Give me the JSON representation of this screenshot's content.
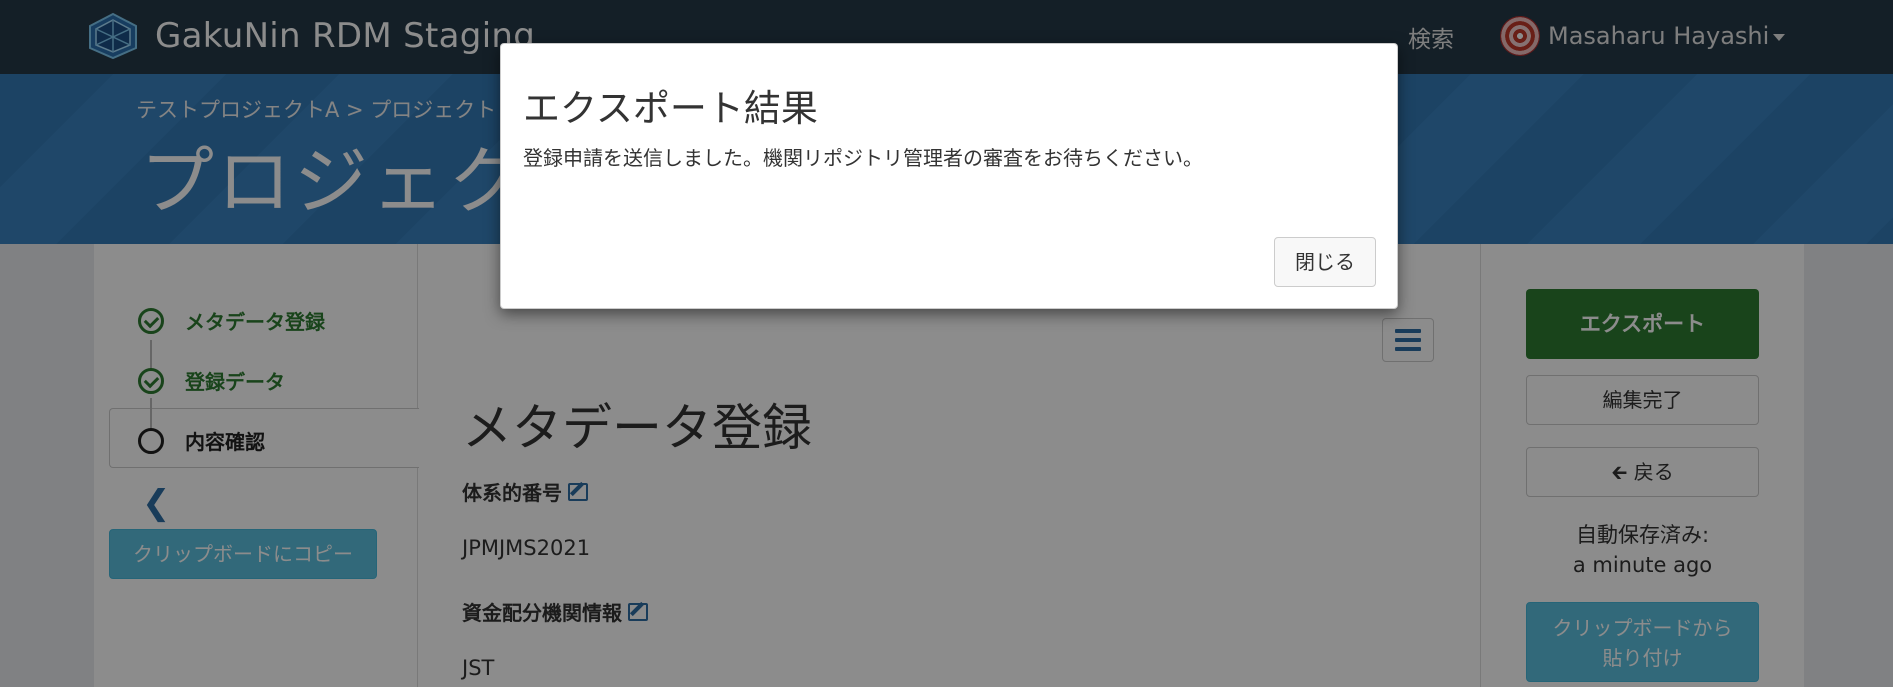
{
  "navbar": {
    "brand": "GakuNin RDM Staging",
    "search_label": "検索",
    "user_name": "Masaharu Hayashi"
  },
  "hero": {
    "breadcrumb": "テストプロジェクトA > プロジェクト >",
    "title": "プロジェク"
  },
  "steps": [
    {
      "label": "メタデータ登録",
      "state": "done"
    },
    {
      "label": "登録データ",
      "state": "done"
    },
    {
      "label": "内容確認",
      "state": "current"
    }
  ],
  "left": {
    "copy_button": "クリップボードにコピー"
  },
  "content": {
    "section_title": "メタデータ登録",
    "fields": [
      {
        "label": "体系的番号",
        "value": "JPMJMS2021"
      },
      {
        "label": "資金配分機関情報",
        "value": "JST"
      }
    ]
  },
  "right": {
    "export_button": "エクスポート",
    "edit_done_button": "編集完了",
    "back_button": "戻る",
    "autosave_label": "自動保存済み:",
    "autosave_time": "a minute ago",
    "paste_button_line1": "クリップボードから",
    "paste_button_line2": "貼り付け"
  },
  "modal": {
    "title": "エクスポート結果",
    "message": "登録申請を送信しました。機関リポジトリ管理者の審査をお待ちください。",
    "close_button": "閉じる"
  },
  "colors": {
    "navbar": "#263947",
    "hero": "#337ab7",
    "success": "#2e7d32",
    "info": "#5bc0de",
    "link": "#2e6da4"
  }
}
